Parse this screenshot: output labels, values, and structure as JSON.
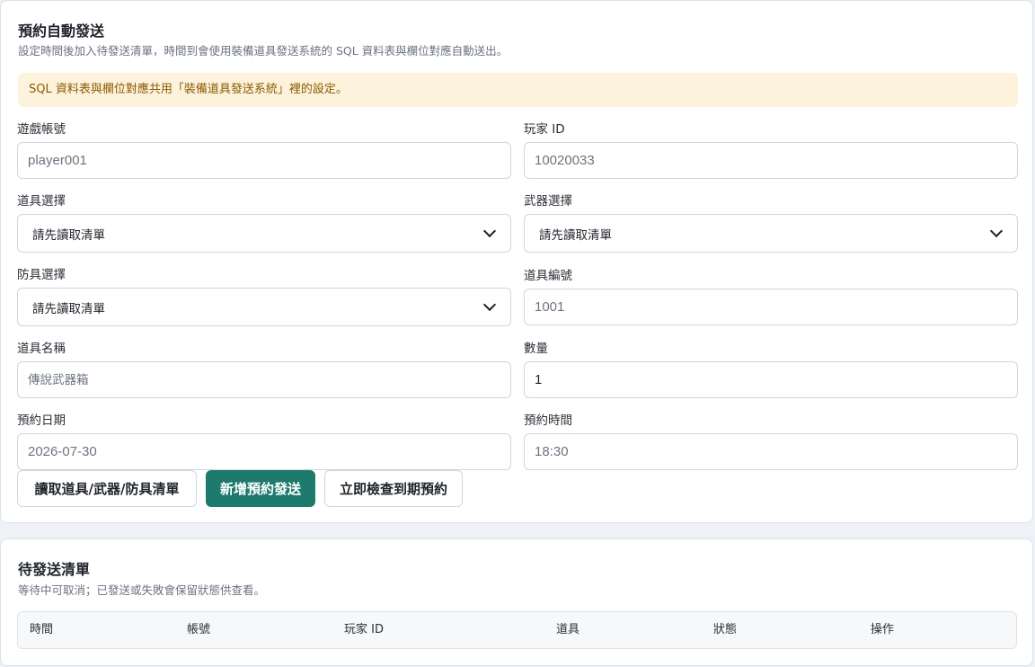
{
  "schedule": {
    "title": "預約自動發送",
    "subtitle": "設定時間後加入待發送清單，時間到會使用裝備道具發送系統的 SQL 資料表與欄位對應自動送出。",
    "notice": "SQL 資料表與欄位對應共用「裝備道具發送系統」裡的設定。",
    "fields": {
      "account": {
        "label": "遊戲帳號",
        "placeholder": "player001"
      },
      "player_id": {
        "label": "玩家 ID",
        "placeholder": "10020033"
      },
      "item_select": {
        "label": "道具選擇",
        "value": "請先讀取清單"
      },
      "weapon_select": {
        "label": "武器選擇",
        "value": "請先讀取清單"
      },
      "armor_select": {
        "label": "防具選擇",
        "value": "請先讀取清單"
      },
      "item_code": {
        "label": "道具編號",
        "placeholder": "1001"
      },
      "item_name": {
        "label": "道具名稱",
        "placeholder": "傳說武器箱"
      },
      "quantity": {
        "label": "數量",
        "value": "1"
      },
      "date": {
        "label": "預約日期",
        "placeholder": "2026-07-30"
      },
      "time": {
        "label": "預約時間",
        "placeholder": "18:30"
      }
    },
    "buttons": {
      "load": "讀取道具/武器/防具清單",
      "add": "新增預約發送",
      "check": "立即檢查到期預約"
    },
    "colors": {
      "primary": "#1f7a6e",
      "notice_bg": "#fdf3dc",
      "notice_text": "#8a5a00"
    }
  },
  "queue": {
    "title": "待發送清單",
    "subtitle": "等待中可取消；已發送或失敗會保留狀態供查看。",
    "columns": [
      "時間",
      "帳號",
      "玩家 ID",
      "道具",
      "狀態",
      "操作"
    ]
  }
}
